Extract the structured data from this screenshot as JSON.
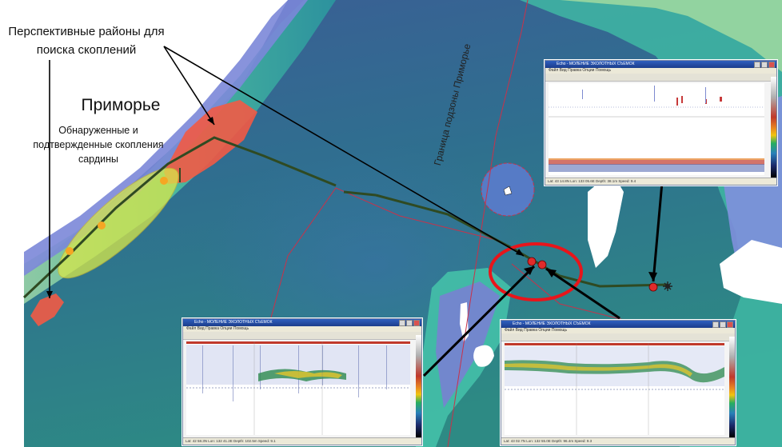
{
  "labels": {
    "prospective_zones": "Перспективные районы для поиска скоплений",
    "region_name": "Приморье",
    "found_schools": "Обнаруженные и подтвержденные скопления сардины",
    "subzone_border": "Граница подзоны Приморье"
  },
  "colors": {
    "prospective_zone_fill": "#f25a45",
    "school_zone_fill": "#d8e84a",
    "school_marker": "#f5a623",
    "highlight_circle": "#e8151b",
    "station_marker": "#e02b2b",
    "vessel_track": "#2f4a22",
    "subzone_boundary": "#c8324a",
    "land": "#ffffff"
  },
  "icons": [
    "vessel-icon"
  ],
  "echograms": [
    {
      "id": "top-right",
      "title": "Echo - МОЛЕНИЕ ЭХОЛОТНЫХ СЪЕМОК",
      "menu": "Файл  Вид  Правка  Опции  Помощь",
      "status": "Lat: 43 14.8N  Lon: 133 05.6E  Depth: 38.1m  Speed: 9.4"
    },
    {
      "id": "bottom-left",
      "title": "Echo - МОЛЕНИЕ ЭХОЛОТНЫХ СЪЕМОК",
      "menu": "Файл  Вид  Правка  Опции  Помощь",
      "status": "Lat: 42 58.3N  Lon: 132 41.2E  Depth: 102.5m  Speed: 9.1"
    },
    {
      "id": "bottom-right",
      "title": "Echo - МОЛЕНИЕ ЭХОЛОТНЫХ СЪЕМОК",
      "menu": "Файл  Вид  Правка  Опции  Помощь",
      "status": "Lat: 43 02.7N  Lon: 132 55.0E  Depth: 96.4m  Speed: 9.3"
    }
  ]
}
